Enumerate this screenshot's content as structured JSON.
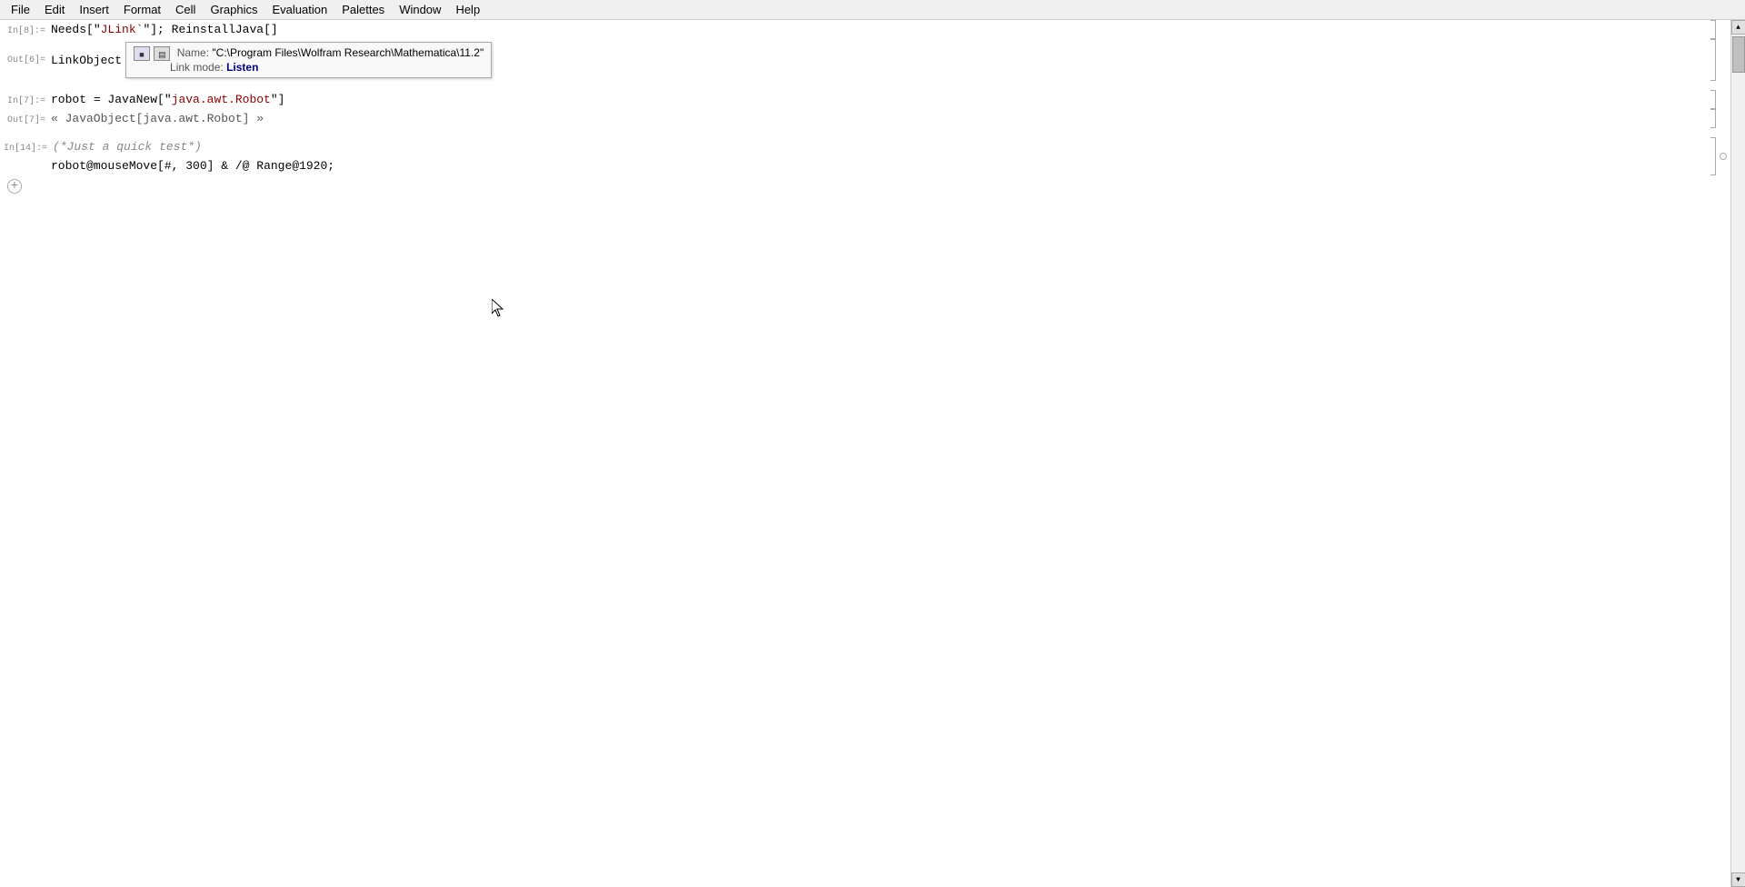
{
  "menubar": {
    "items": [
      "File",
      "Edit",
      "Insert",
      "Format",
      "Cell",
      "Graphics",
      "Evaluation",
      "Palettes",
      "Window",
      "Help"
    ]
  },
  "notebook": {
    "cells": [
      {
        "id": "cell1",
        "type": "input",
        "label": "In[8]:=",
        "code": "Needs[\"JLink`\"]; ReinstallJava[]",
        "code_parts": [
          {
            "text": "Needs",
            "class": "fn"
          },
          {
            "text": "[",
            "class": "sym"
          },
          {
            "text": "\"JLink`\"",
            "class": "str"
          },
          {
            "text": "]; ",
            "class": "sym"
          },
          {
            "text": "ReinstallJava",
            "class": "fn"
          },
          {
            "text": "[]",
            "class": "sym"
          }
        ]
      },
      {
        "id": "cell2",
        "type": "output",
        "label": "Out[6]=",
        "code": "LinkObject",
        "tooltip": {
          "visible": true,
          "name_label": "Name: ",
          "name_value": "\"C:\\Program Files\\Wolfram Research\\Mathematica\\11.2\"",
          "mode_label": "Link mode: ",
          "mode_value": "Listen"
        }
      },
      {
        "id": "cell3",
        "type": "input",
        "label": "In[7]:=",
        "code": "robot = JavaNew[\"java.awt.Robot\"]",
        "code_parts": [
          {
            "text": "robot",
            "class": "sym"
          },
          {
            "text": " = ",
            "class": "sym"
          },
          {
            "text": "JavaNew",
            "class": "fn"
          },
          {
            "text": "[",
            "class": "sym"
          },
          {
            "text": "\"java.awt.Robot\"",
            "class": "str"
          },
          {
            "text": "]",
            "class": "sym"
          }
        ]
      },
      {
        "id": "cell4",
        "type": "output",
        "label": "Out[7]=",
        "code": "« JavaObject[java.awt.Robot] »"
      },
      {
        "id": "cell5",
        "type": "input",
        "label": "In[14]:=",
        "lines": [
          {
            "code": "(*Just a quick test*)",
            "class": "cmt"
          },
          {
            "code": "robot@mouseMove[#, 300] & /@ Range@1920;"
          }
        ]
      }
    ],
    "add_cell_label": "+"
  }
}
